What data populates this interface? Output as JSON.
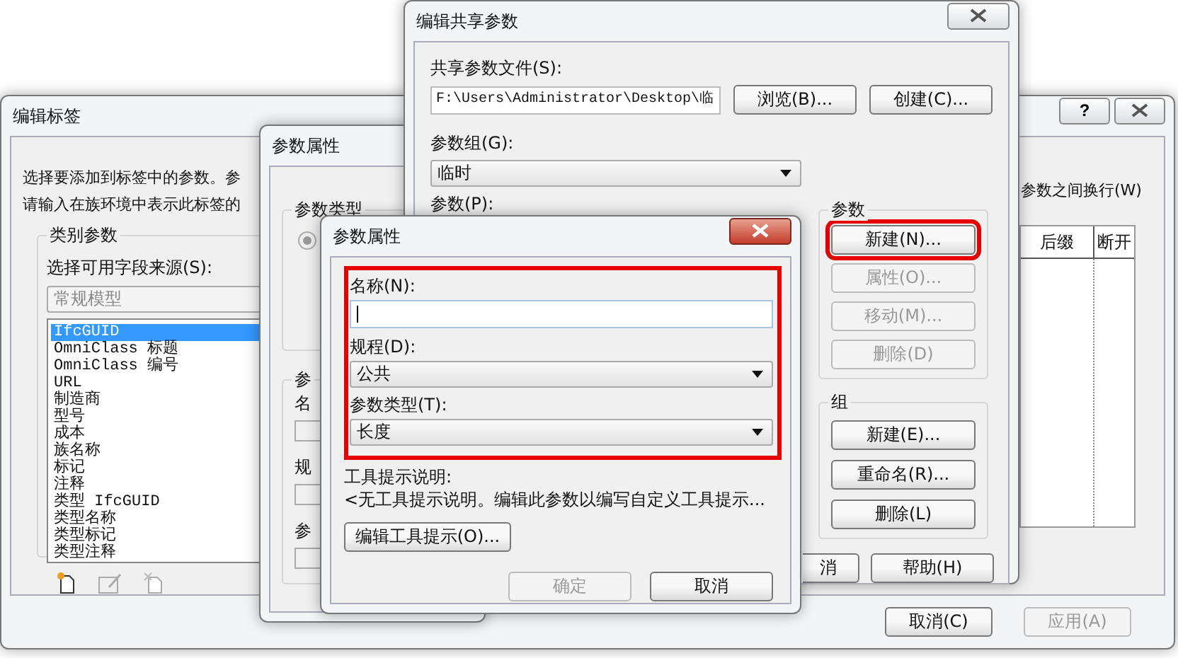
{
  "edit_label_dialog": {
    "title": "编辑标签",
    "help_button": "?",
    "instructions": [
      "选择要添加到标签中的参数。参",
      "请输入在族环境中表示此标签的"
    ],
    "category_group": {
      "label": "类别参数",
      "source_label": "选择可用字段来源(S):",
      "source_value": "常规模型",
      "parameters": [
        {
          "label": "IfcGUID",
          "selected": true
        },
        {
          "label": "OmniClass 标题",
          "selected": false
        },
        {
          "label": "OmniClass 编号",
          "selected": false
        },
        {
          "label": "URL",
          "selected": false
        },
        {
          "label": "制造商",
          "selected": false
        },
        {
          "label": "型号",
          "selected": false
        },
        {
          "label": "成本",
          "selected": false
        },
        {
          "label": "族名称",
          "selected": false
        },
        {
          "label": "标记",
          "selected": false
        },
        {
          "label": "注释",
          "selected": false
        },
        {
          "label": "类型 IfcGUID",
          "selected": false
        },
        {
          "label": "类型名称",
          "selected": false
        },
        {
          "label": "类型标记",
          "selected": false
        },
        {
          "label": "类型注释",
          "selected": false
        }
      ]
    },
    "wrap_option": "参数之间换行(W)",
    "table_columns": [
      "后缀",
      "断开"
    ],
    "buttons": [
      {
        "label": "取消(C)",
        "disabled": false
      },
      {
        "label": "应用(A)",
        "disabled": true
      }
    ]
  },
  "parameter_properties_back": {
    "title": "参数属性",
    "type_group_label": "参数类型",
    "radio_selected": true,
    "group_label": "参",
    "field_labels": [
      "名",
      "规",
      "参"
    ]
  },
  "shared_parameters_dialog": {
    "title": "编辑共享参数",
    "file_label": "共享参数文件(S):",
    "file_path": "F:\\Users\\Administrator\\Desktop\\临",
    "file_buttons": [
      "浏览(B)...",
      "创建(C)..."
    ],
    "group_label": "参数组(G):",
    "group_value": "临时",
    "parameters_label": "参数(P):",
    "parameter_actions": {
      "label": "参数",
      "buttons": [
        {
          "label": "新建(N)...",
          "disabled": false,
          "highlighted": true
        },
        {
          "label": "属性(O)...",
          "disabled": true,
          "highlighted": false
        },
        {
          "label": "移动(M)...",
          "disabled": true,
          "highlighted": false
        },
        {
          "label": "删除(D)",
          "disabled": true,
          "highlighted": false
        }
      ]
    },
    "group_actions": {
      "label": "组",
      "buttons": [
        {
          "label": "新建(E)...",
          "disabled": false
        },
        {
          "label": "重命名(R)...",
          "disabled": false
        },
        {
          "label": "删除(L)",
          "disabled": false
        }
      ]
    },
    "footer_buttons": [
      "消",
      "帮助(H)"
    ]
  },
  "parameter_properties_front": {
    "title": "参数属性",
    "highlighted": true,
    "name_label": "名称(N):",
    "discipline_label": "规程(D):",
    "discipline_value": "公共",
    "type_label": "参数类型(T):",
    "type_value": "长度",
    "tooltip_label": "工具提示说明:",
    "tooltip_text": "<无工具提示说明。编辑此参数以编写自定义工具提示...",
    "edit_tooltip_button": "编辑工具提示(O)...",
    "buttons": [
      {
        "label": "确定",
        "disabled": true
      },
      {
        "label": "取消",
        "disabled": false
      }
    ]
  }
}
